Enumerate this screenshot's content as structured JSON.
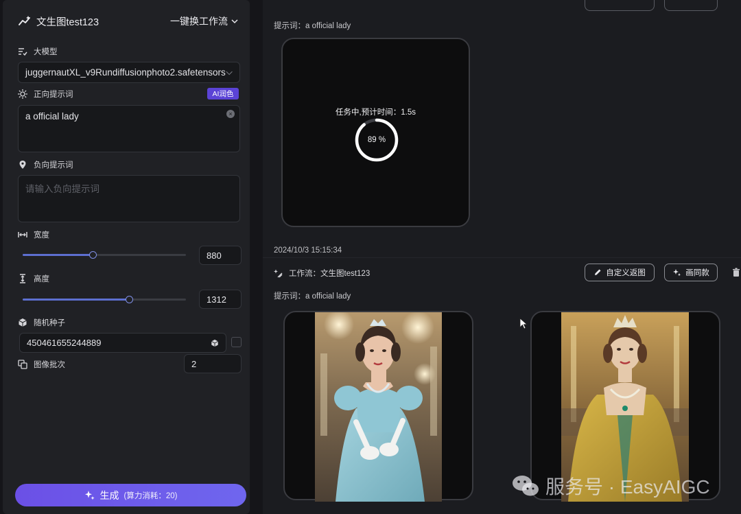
{
  "sidebar": {
    "header": {
      "title": "文生图test123",
      "switch_label": "一键换工作流"
    },
    "model": {
      "label": "大模型",
      "value": "juggernautXL_v9Rundiffusionphoto2.safetensors"
    },
    "positive": {
      "label": "正向提示词",
      "ai_button": "AI润色",
      "value": "a official lady"
    },
    "negative": {
      "label": "负向提示词",
      "placeholder": "请输入负向提示词"
    },
    "width": {
      "label": "宽度",
      "value": "880",
      "fill": 0.43
    },
    "height": {
      "label": "高度",
      "value": "1312",
      "fill": 0.65
    },
    "seed": {
      "label": "随机种子",
      "value": "450461655244889"
    },
    "batch": {
      "label": "图像批次",
      "value": "2"
    },
    "generate": {
      "label": "生成",
      "cost": "(算力消耗：20)"
    }
  },
  "results": {
    "job1": {
      "prompt": "提示词：a official lady",
      "task_status": "任务中,预计时间：1.5s",
      "progress_label": "89 %",
      "progress": 0.89
    },
    "job2": {
      "timestamp": "2024/10/3 15:15:34",
      "workflow": "工作流：文生图test123",
      "custom_button": "自定义返图",
      "same_button": "画同款",
      "prompt": "提示词：a official lady"
    }
  },
  "watermark": "服务号 · EasyAIGC",
  "colors": {
    "accent": "#5b43d6",
    "slider": "#5d6fd0",
    "panel": "#202125"
  }
}
